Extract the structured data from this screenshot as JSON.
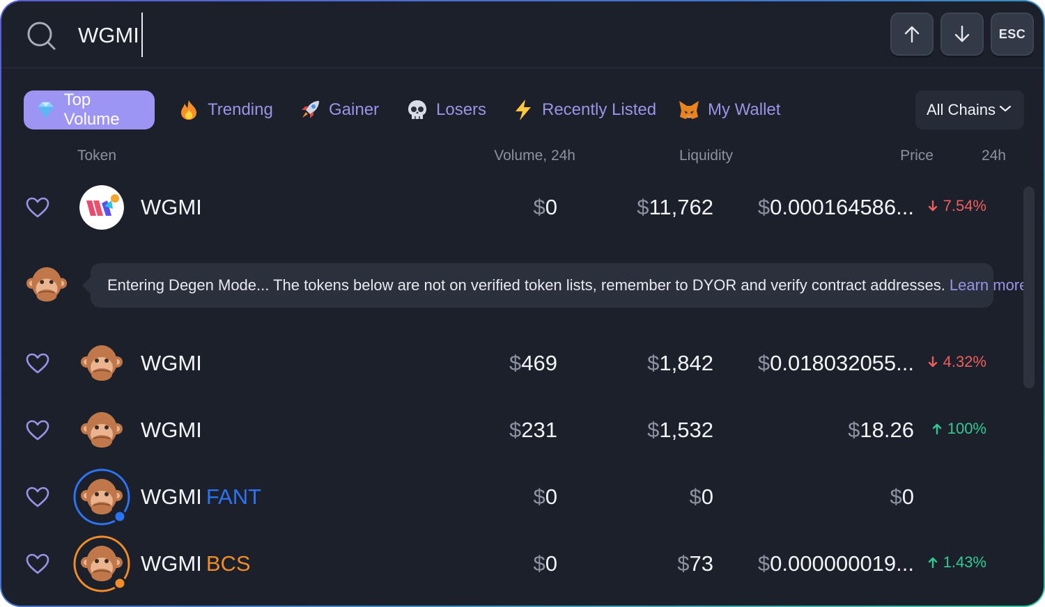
{
  "search": {
    "value": "WGMI",
    "placeholder": ""
  },
  "keys": {
    "up": "↑",
    "down": "↓",
    "esc": "ESC"
  },
  "tabs": [
    {
      "label": "Top Volume",
      "icon": "diamond-icon",
      "active": true
    },
    {
      "label": "Trending",
      "icon": "fire-icon"
    },
    {
      "label": "Gainer",
      "icon": "rocket-icon"
    },
    {
      "label": "Losers",
      "icon": "skull-icon"
    },
    {
      "label": "Recently Listed",
      "icon": "lightning-icon"
    },
    {
      "label": "My Wallet",
      "icon": "fox-icon"
    }
  ],
  "chain_select": {
    "value": "All Chains"
  },
  "columns": {
    "token": "Token",
    "volume": "Volume, 24h",
    "liquidity": "Liquidity",
    "price": "Price",
    "change": "24h"
  },
  "currency_symbol": "$",
  "verified_rows": [
    {
      "name": "WGMI",
      "tag": "",
      "volume": "0",
      "liquidity": "11,762",
      "price": "0.000164586...",
      "change": "7.54%",
      "direction": "down",
      "avatar": "wgmi-logo"
    }
  ],
  "degen_notice": {
    "text": "Entering Degen Mode... The tokens below are not on verified token lists, remember to DYOR and verify contract addresses.",
    "link": "Learn more"
  },
  "degen_rows": [
    {
      "name": "WGMI",
      "tag": "",
      "volume": "469",
      "liquidity": "1,842",
      "price": "0.018032055...",
      "change": "4.32%",
      "direction": "down"
    },
    {
      "name": "WGMI",
      "tag": "",
      "volume": "231",
      "liquidity": "1,532",
      "price": "18.26",
      "change": "100%",
      "direction": "up"
    },
    {
      "name": "WGMI",
      "tag": "FANT",
      "volume": "0",
      "liquidity": "0",
      "price": "0",
      "change": "",
      "direction": "",
      "ring": "#2d74f5"
    },
    {
      "name": "WGMI",
      "tag": "BCS",
      "volume": "0",
      "liquidity": "73",
      "price": "0.000000019...",
      "change": "1.43%",
      "direction": "up",
      "ring": "#f28c28"
    }
  ],
  "colors": {
    "accent": "#9d95f4",
    "negative": "#f05d5d",
    "positive": "#2fcb92",
    "background": "#1b202b"
  }
}
